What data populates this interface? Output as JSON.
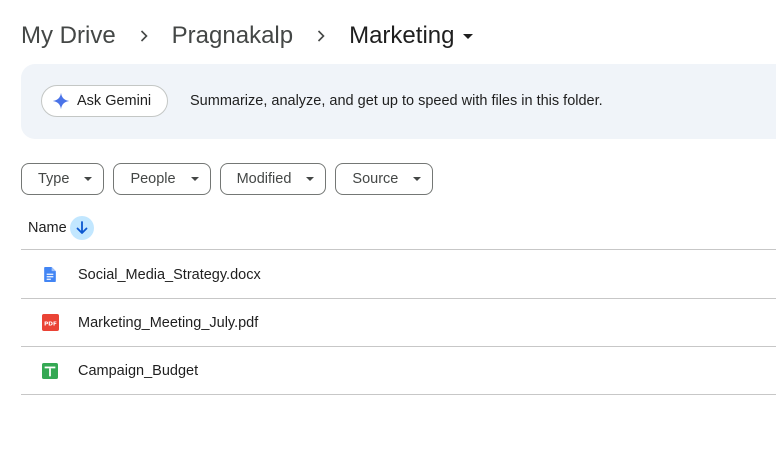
{
  "breadcrumb": {
    "items": [
      {
        "label": "My Drive"
      },
      {
        "label": "Pragnakalp"
      },
      {
        "label": "Marketing"
      }
    ]
  },
  "gemini": {
    "button_label": "Ask Gemini",
    "description": "Summarize, analyze, and get up to speed with files in this folder."
  },
  "filters": [
    {
      "label": "Type"
    },
    {
      "label": "People"
    },
    {
      "label": "Modified"
    },
    {
      "label": "Source"
    }
  ],
  "list": {
    "column_name": "Name",
    "sort": "descending",
    "files": [
      {
        "name": "Social_Media_Strategy.docx",
        "icon": "docs-icon"
      },
      {
        "name": "Marketing_Meeting_July.pdf",
        "icon": "pdf-icon"
      },
      {
        "name": "Campaign_Budget",
        "icon": "sheets-icon"
      }
    ]
  },
  "colors": {
    "banner_bg": "#f0f4f9",
    "sort_bg": "#c2e7ff",
    "docs_blue": "#4285f4",
    "pdf_red": "#ea4335",
    "sheets_green": "#34a853",
    "gemini_blue": "#4a73e8"
  }
}
